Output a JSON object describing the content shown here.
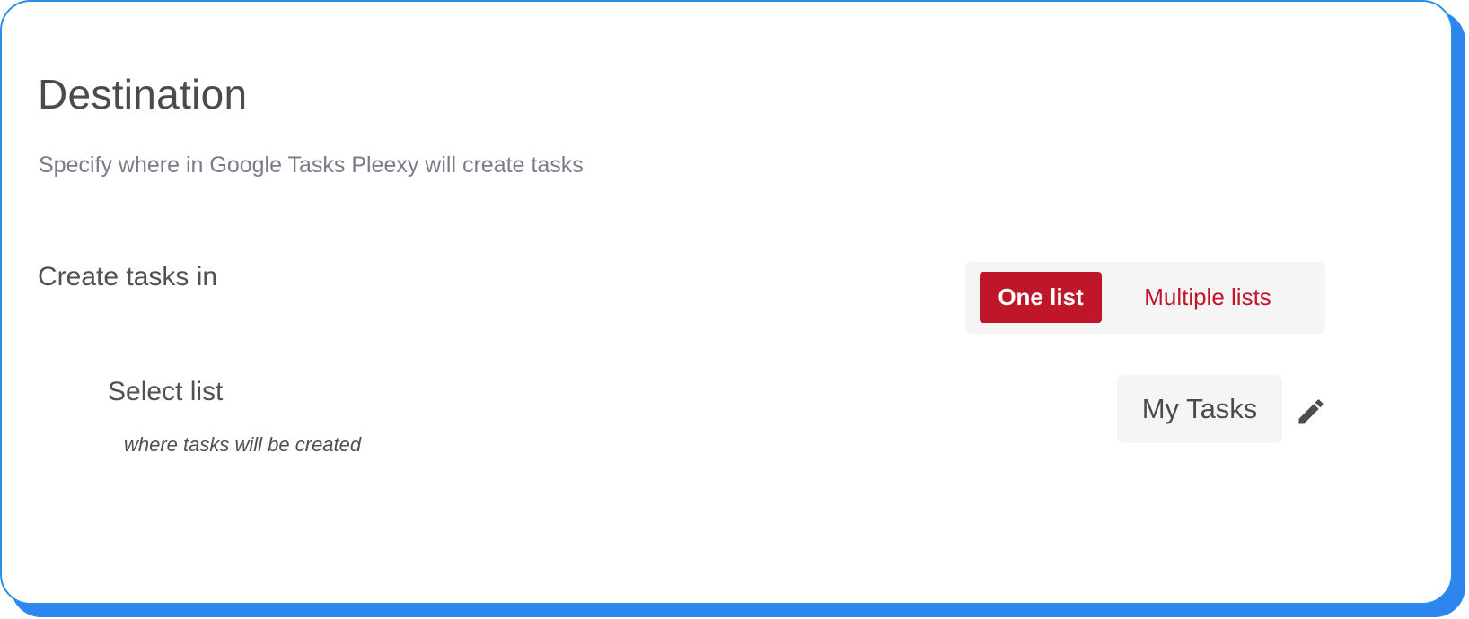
{
  "destination": {
    "title": "Destination",
    "subtitle": "Specify where in Google Tasks Pleexy will create tasks"
  },
  "create_tasks": {
    "label": "Create tasks in",
    "options": [
      "One list",
      "Multiple lists"
    ],
    "selected": "One list"
  },
  "select_list": {
    "label": "Select list",
    "hint": "where tasks will be created",
    "value": "My Tasks",
    "edit_icon": "pencil-icon"
  },
  "colors": {
    "accent": "#c0162a",
    "border": "#2b8fe6",
    "shadow": "#2d86f0"
  }
}
